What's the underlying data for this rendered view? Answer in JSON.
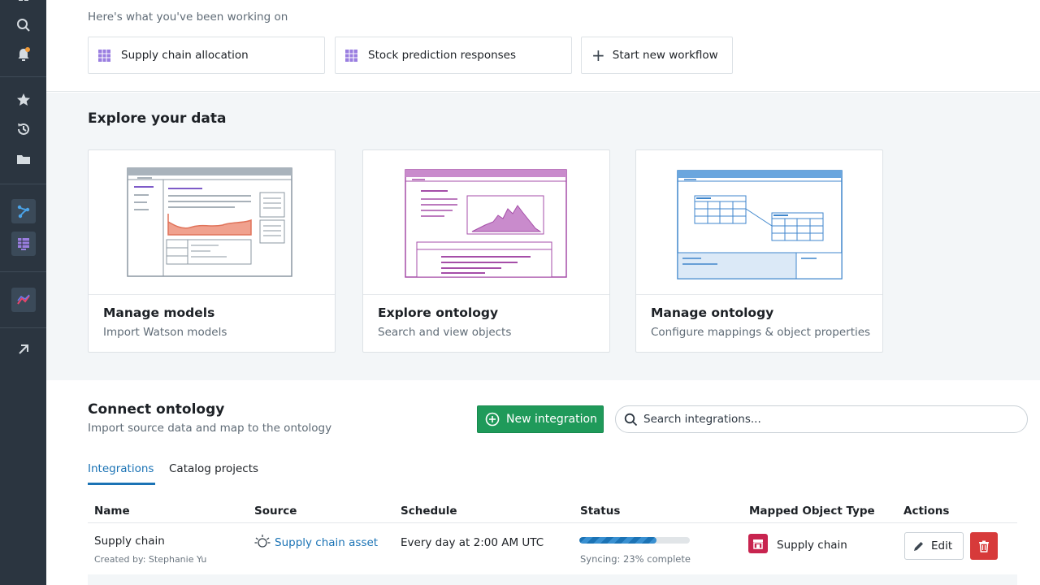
{
  "recent": {
    "heading": "Here's what you've been working on",
    "items": [
      {
        "label": "Supply chain allocation",
        "icon": "grid-icon"
      },
      {
        "label": "Stock prediction responses",
        "icon": "grid-icon"
      },
      {
        "label": "Start new workflow",
        "icon": "plus-icon"
      }
    ]
  },
  "explore": {
    "title": "Explore your data",
    "cards": [
      {
        "title": "Manage models",
        "subtitle": "Import Watson models",
        "accent": "#e0735a"
      },
      {
        "title": "Explore ontology",
        "subtitle": "Search and view objects",
        "accent": "#a54ea8"
      },
      {
        "title": "Manage ontology",
        "subtitle": "Configure mappings & object properties",
        "accent": "#3f86cc"
      }
    ]
  },
  "connect": {
    "title": "Connect ontology",
    "subtitle": "Import source data and map to the ontology",
    "new_button": "New integration",
    "search_placeholder": "Search integrations...",
    "tabs": [
      "Integrations",
      "Catalog projects"
    ],
    "columns": [
      "Name",
      "Source",
      "Schedule",
      "Status",
      "Mapped Object Type",
      "Actions"
    ],
    "rows": [
      {
        "name": "Supply chain",
        "created_by": "Created by: Stephanie Yu",
        "source": "Supply chain asset",
        "schedule": "Every day at 2:00 AM UTC",
        "status": "Syncing: 23% complete",
        "progress": 0.7,
        "object_type": "Supply chain",
        "edit_label": "Edit"
      }
    ]
  },
  "colors": {
    "sidebar": "#2b3540",
    "primary": "#1b73b5",
    "success": "#1f9a5a",
    "danger": "#d73a3a",
    "object": "#c8244f"
  }
}
